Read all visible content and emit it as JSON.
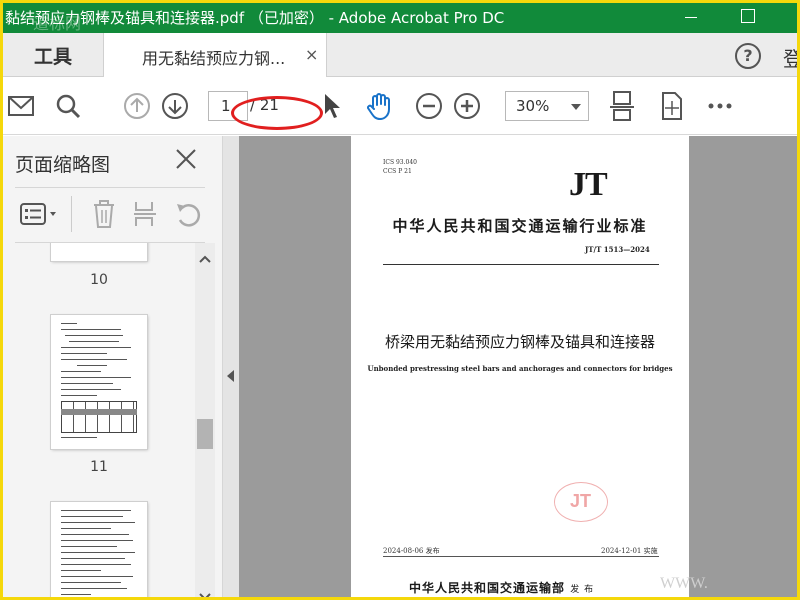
{
  "titlebar": {
    "title": "黏结预应力钢棒及锚具和连接器.pdf （已加密） - Adobe Acrobat Pro DC",
    "watermark": "道标网",
    "accent": "#118a3a"
  },
  "tabs": {
    "tools_label": "工具",
    "doc_label": "用无黏结预应力钢...",
    "close_glyph": "×",
    "help_glyph": "?",
    "login_label": "登"
  },
  "toolbar": {
    "icons": [
      "mail-icon",
      "search-icon",
      "prev-page-icon",
      "next-page-icon",
      "select-cursor-icon",
      "hand-tool-icon",
      "zoom-out-icon",
      "zoom-in-icon",
      "fit-page-icon",
      "rotate-view-icon",
      "more-icon"
    ],
    "page_current": "1",
    "page_total": "/ 21",
    "zoom_value": "30%"
  },
  "panel": {
    "title": "页面缩略图",
    "thumbnails": [
      {
        "label": "10"
      },
      {
        "label": "11"
      }
    ]
  },
  "document": {
    "ics": "ICS 93.040",
    "ccs": "CCS P 21",
    "logo": "JT",
    "standard_type": "中华人民共和国交通运输行业标准",
    "standard_number": "JT/T 1513—2024",
    "title_cn": "桥梁用无黏结预应力钢棒及锚具和连接器",
    "title_en": "Unbonded prestressing steel bars and anchorages and connectors for bridges",
    "seal_text": "JT",
    "issue_date": "2024-08-06 发布",
    "impl_date": "2024-12-01 实施",
    "ministry": "中华人民共和国交通运输部",
    "ministry_suffix": "发 布",
    "www": "WWW."
  }
}
